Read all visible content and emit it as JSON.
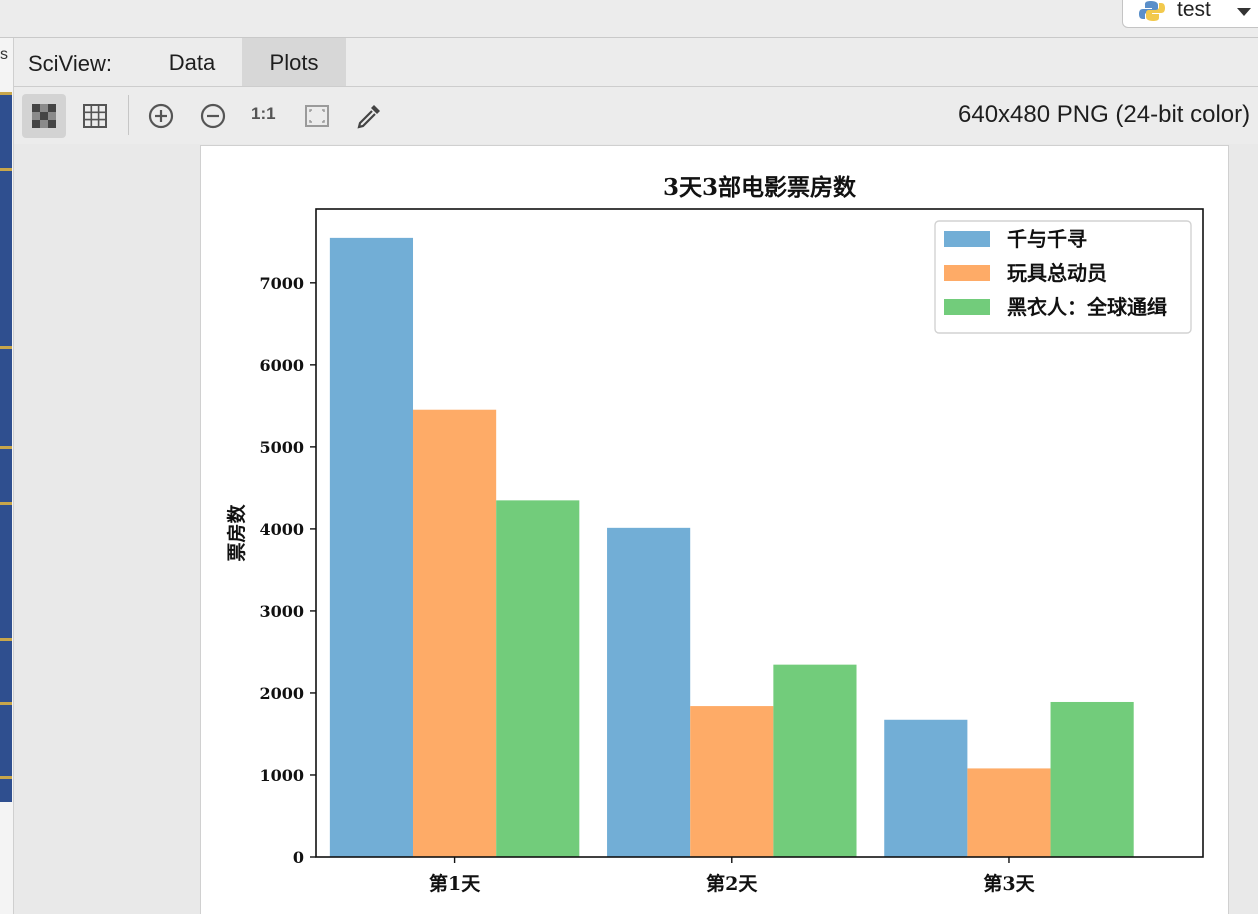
{
  "run_config": {
    "name": "test",
    "icon": "python-icon"
  },
  "sciview": {
    "title": "SciView:",
    "tabs": [
      {
        "label": "Data",
        "active": false
      },
      {
        "label": "Plots",
        "active": true
      }
    ]
  },
  "toolbar": {
    "buttons": [
      {
        "name": "fit-view-icon",
        "active": true
      },
      {
        "name": "grid-icon",
        "active": false
      },
      {
        "name": "zoom-in-icon",
        "active": false
      },
      {
        "name": "zoom-out-icon",
        "active": false
      },
      {
        "name": "actual-size-label",
        "active": false
      },
      {
        "name": "fit-window-icon",
        "active": false
      },
      {
        "name": "color-picker-icon",
        "active": false
      }
    ],
    "actual_size_label": "1:1",
    "image_info": "640x480 PNG (24-bit color)"
  },
  "chart_data": {
    "type": "bar",
    "title": "3天3部电影票房数",
    "xlabel": "",
    "ylabel": "票房数",
    "categories": [
      "第1天",
      "第2天",
      "第3天"
    ],
    "ylim": [
      0,
      7900
    ],
    "yticks": [
      0,
      1000,
      2000,
      3000,
      4000,
      5000,
      6000,
      7000
    ],
    "grid": false,
    "legend_position": "top-right",
    "series": [
      {
        "name": "千与千寻",
        "color": "#72aed6",
        "values": [
          7548,
          4013,
          1673
        ]
      },
      {
        "name": "玩具总动员",
        "color": "#feab67",
        "values": [
          5453,
          1840,
          1080
        ]
      },
      {
        "name": "黑衣人：全球通缉",
        "color": "#72cc7b",
        "values": [
          4348,
          2345,
          1890
        ]
      }
    ]
  }
}
